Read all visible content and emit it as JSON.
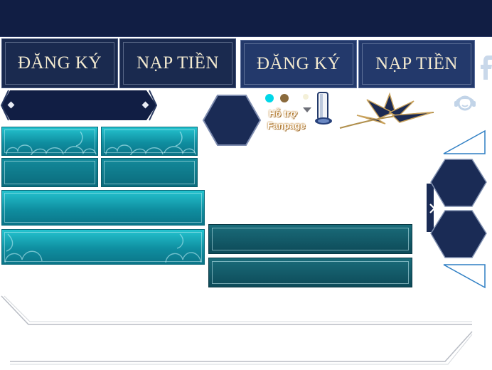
{
  "nav": {
    "register_label": "ĐĂNG KÝ",
    "topup_label": "NẠP TIỀN",
    "register_label_alt": "ĐĂNG KÝ",
    "topup_label_alt": "NẠP TIỀN"
  },
  "support": {
    "line1": "Hỗ trợ",
    "line2": "Fanpage"
  },
  "colors": {
    "navy": "#111e44",
    "teal": "#16a9b8",
    "teal_dark": "#0d4a58",
    "accent_blue": "#2f7fc4"
  },
  "icons": {
    "facebook": "facebook-icon",
    "support": "support-agent-icon",
    "arrow": "chevron-right-icon",
    "dropdown": "caret-down-icon"
  }
}
